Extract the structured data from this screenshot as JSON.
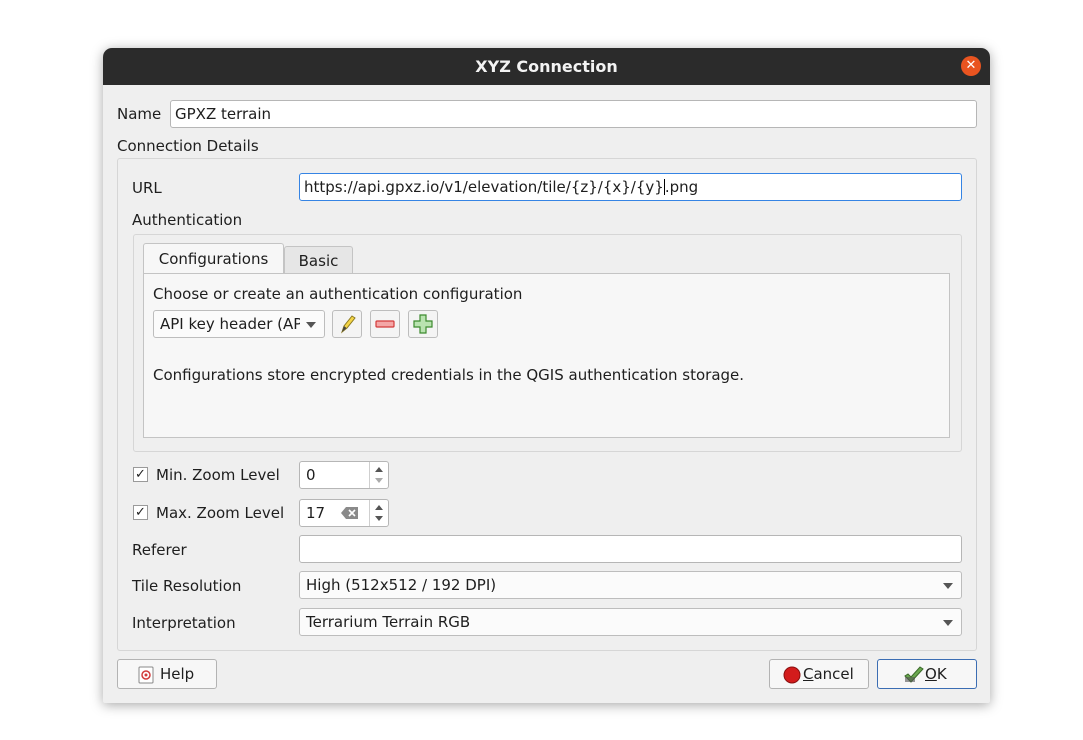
{
  "window": {
    "title": "XYZ Connection",
    "close_symbol": "✕"
  },
  "name": {
    "label": "Name",
    "value": "GPXZ terrain"
  },
  "connection_details": {
    "label": "Connection Details",
    "url": {
      "label": "URL",
      "value_before_cursor": "https://api.gpxz.io/v1/elevation/tile/{z}/{x}/{y}",
      "value_after_cursor": ".png"
    },
    "authentication": {
      "label": "Authentication",
      "tabs": [
        {
          "label": "Configurations"
        },
        {
          "label": "Basic"
        }
      ],
      "choose_label": "Choose or create an authentication configuration",
      "selected_config": "API key header (AP",
      "info": "Configurations store encrypted credentials in the QGIS authentication storage."
    },
    "min_zoom": {
      "label": "Min. Zoom Level",
      "checked": "✓",
      "value": "0"
    },
    "max_zoom": {
      "label": "Max. Zoom Level",
      "checked": "✓",
      "value": "17"
    },
    "referer": {
      "label": "Referer",
      "value": ""
    },
    "tile_resolution": {
      "label": "Tile Resolution",
      "value": "High (512x512 / 192 DPI)"
    },
    "interpretation": {
      "label": "Interpretation",
      "value": "Terrarium Terrain RGB"
    }
  },
  "buttons": {
    "help": "Help",
    "cancel_mnemonic": "C",
    "cancel_rest": "ancel",
    "ok_mnemonic": "O",
    "ok_rest": "K"
  },
  "colors": {
    "titlebar": "#2b2b2b",
    "close": "#e95420",
    "focus": "#3584e4",
    "dialog_bg": "#efefef"
  }
}
